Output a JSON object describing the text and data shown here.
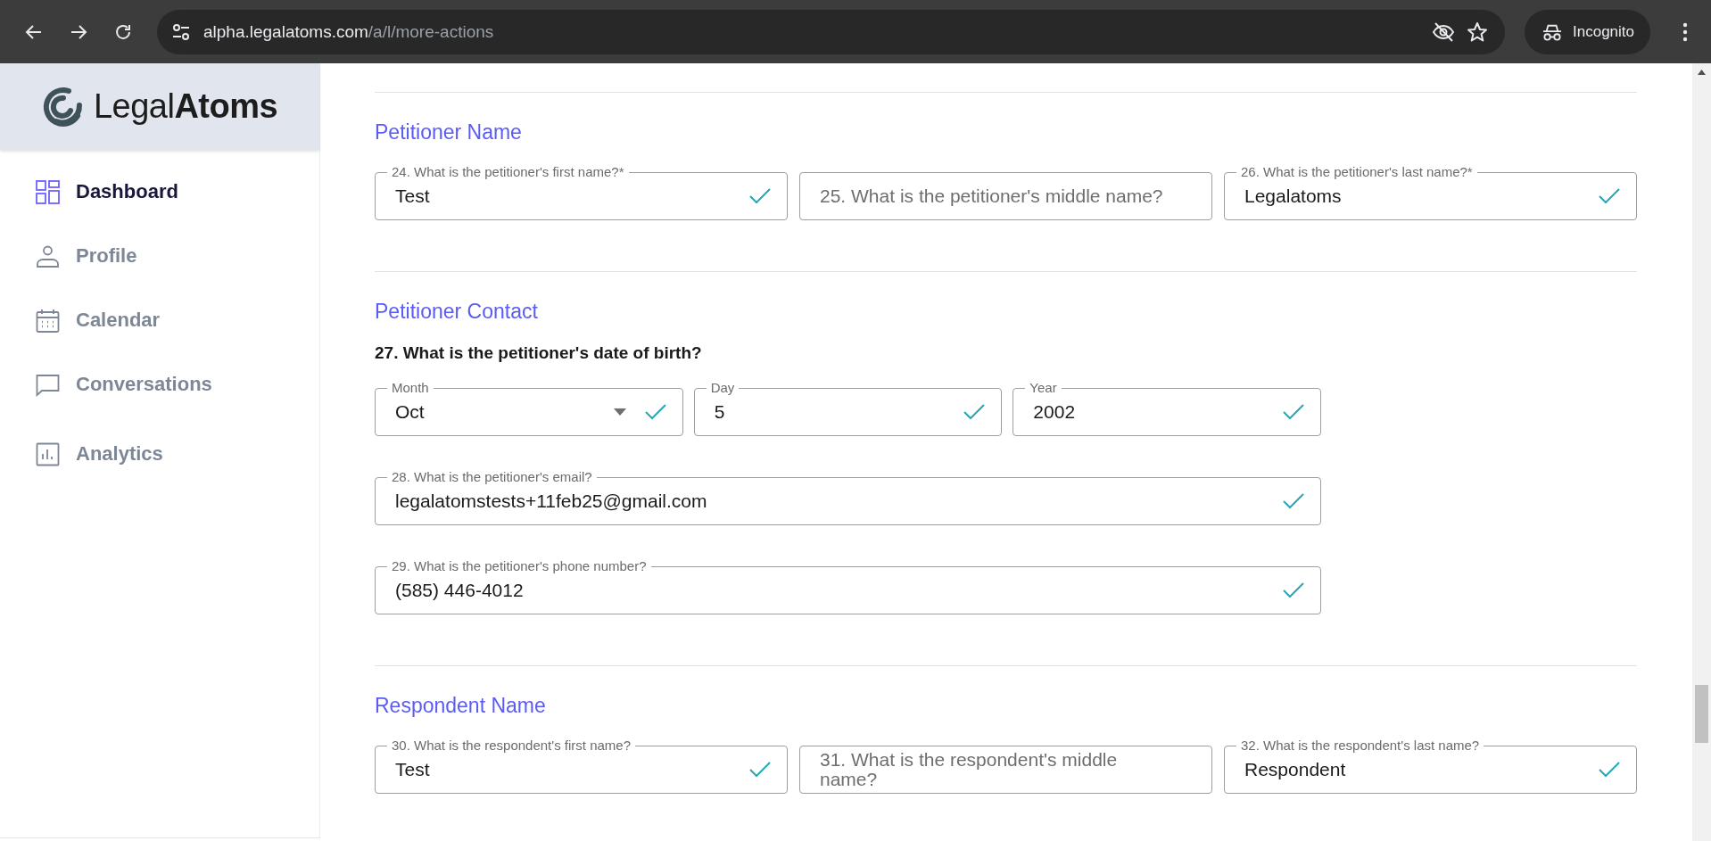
{
  "browser": {
    "url_host": "alpha.legalatoms.com",
    "url_path": "/a/l/more-actions",
    "profile": "Incognito"
  },
  "sidebar": {
    "logo": "Legal**Atoms**",
    "items": [
      {
        "label": "Dashboard",
        "selected": true
      },
      {
        "label": "Profile",
        "selected": false
      },
      {
        "label": "Calendar",
        "selected": false
      },
      {
        "label": "Conversations",
        "selected": false
      },
      {
        "label": "Analytics",
        "selected": false
      }
    ]
  },
  "sections": [
    {
      "title": "Petitioner Name",
      "items": [
        {
          "kind": "wide-row",
          "fields": [
            {
              "kind": "text",
              "label": "24. What is the petitioner's first name?*",
              "value": "Test",
              "valid": true
            },
            {
              "kind": "text",
              "placeholder": "25. What is the petitioner's middle name?",
              "valid": false
            },
            {
              "kind": "text",
              "label": "26. What is the petitioner's last name?*",
              "value": "Legalatoms",
              "valid": true
            }
          ]
        }
      ]
    },
    {
      "title": "Petitioner Contact",
      "items": [
        {
          "kind": "question",
          "text": "27. What is the petitioner's date of birth?"
        },
        {
          "kind": "row",
          "fields": [
            {
              "kind": "select",
              "label": "Month",
              "value": "Oct",
              "valid": true
            },
            {
              "kind": "text",
              "label": "Day",
              "value": "5",
              "valid": true
            },
            {
              "kind": "text",
              "label": "Year",
              "value": "2002",
              "valid": true
            }
          ]
        },
        {
          "kind": "row",
          "fields": [
            {
              "kind": "text",
              "label": "28. What is the petitioner's email?",
              "value": "legalatomstests+11feb25@gmail.com",
              "valid": true
            }
          ]
        },
        {
          "kind": "row",
          "fields": [
            {
              "kind": "text",
              "label": "29. What is the petitioner's phone number?",
              "value": "(585) 446-4012",
              "valid": true
            }
          ]
        }
      ]
    },
    {
      "title": "Respondent Name",
      "items": [
        {
          "kind": "wide-row",
          "fields": [
            {
              "kind": "text",
              "label": "30. What is the respondent's first name?",
              "value": "Test",
              "valid": true
            },
            {
              "kind": "text",
              "placeholder": "31. What is the respondent's middle name?",
              "valid": false
            },
            {
              "kind": "text",
              "label": "32. What is the respondent's last name?",
              "value": "Respondent",
              "valid": true
            }
          ]
        }
      ]
    }
  ]
}
